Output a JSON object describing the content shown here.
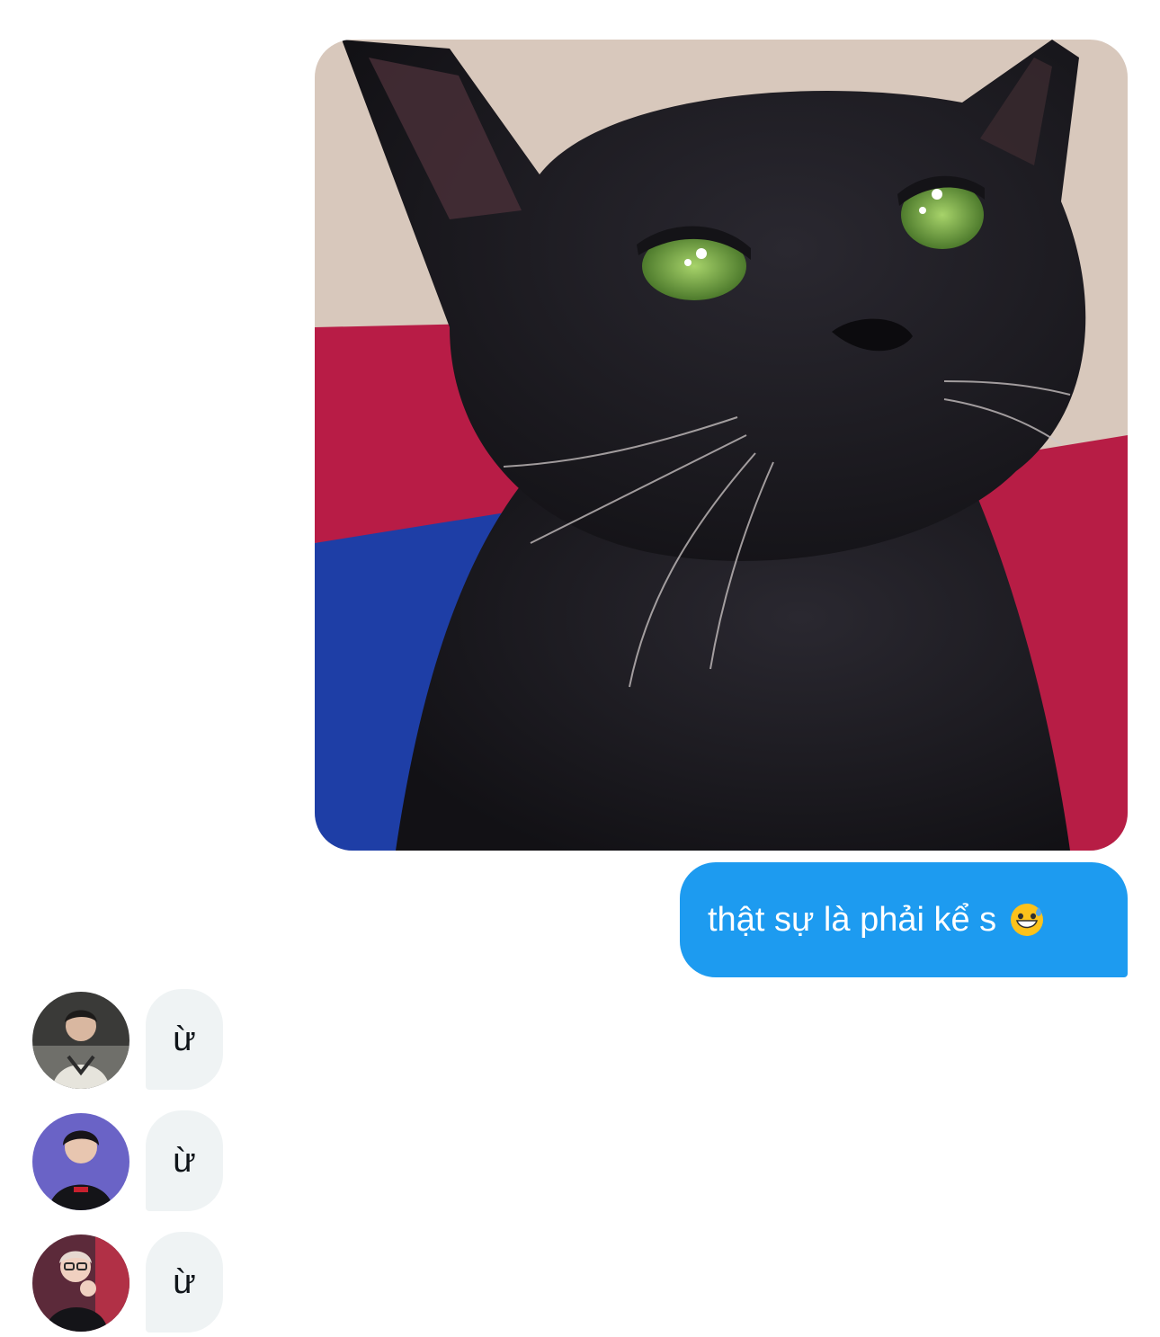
{
  "conversation": {
    "sent_image": {
      "icon": "black-cat-photo",
      "accent_colors": {
        "background": "#d9c9bd",
        "cushion_red": "#b81c46",
        "cushion_blue": "#1c3fa8",
        "cat": "#1b1a1e",
        "eyes": "#7fb84a"
      }
    },
    "sent_message": {
      "text": "thật sự là phải kể s",
      "emoji": "grinning-face-with-sweat-emoji",
      "bubble_color": "#1d9bf0"
    },
    "received_messages": [
      {
        "text": "ừ",
        "avatar": "user-avatar-1"
      },
      {
        "text": "ừ",
        "avatar": "user-avatar-2"
      },
      {
        "text": "ừ",
        "avatar": "user-avatar-3"
      }
    ],
    "received_bubble_color": "#eff3f4"
  }
}
